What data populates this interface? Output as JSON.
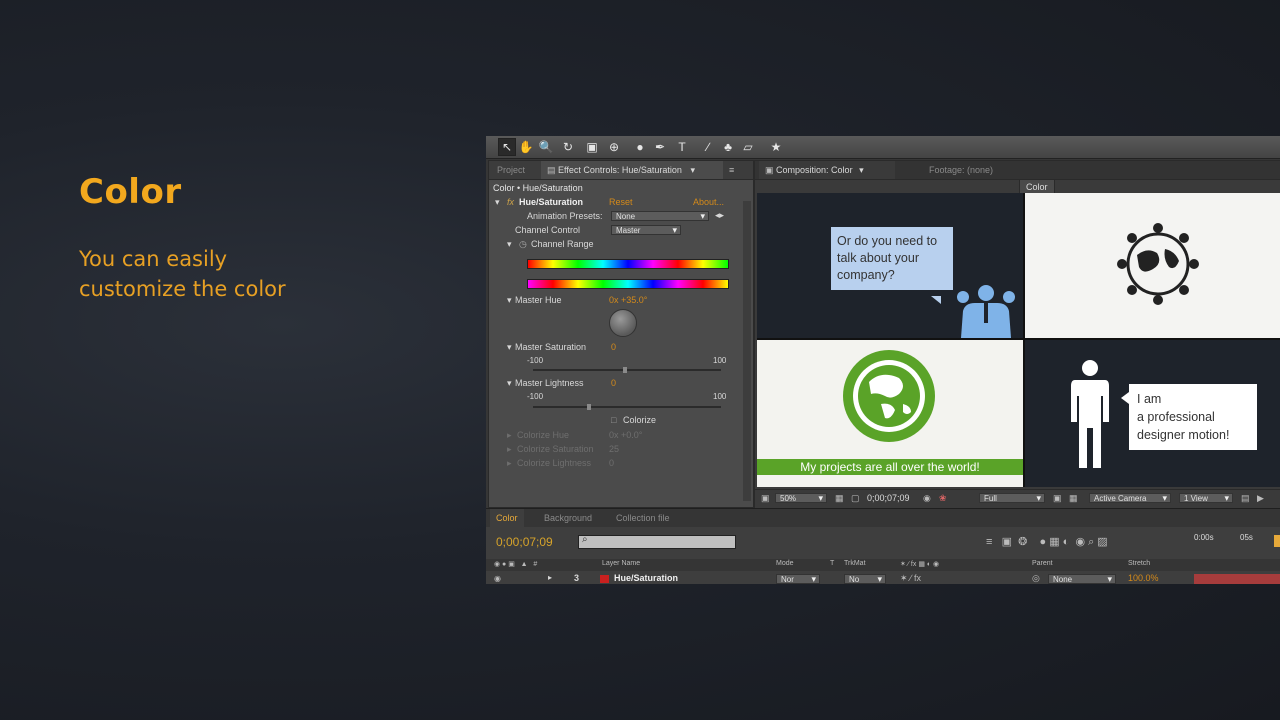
{
  "slide": {
    "heading": "Color",
    "subtext_line1": "You can easily",
    "subtext_line2": "customize the color"
  },
  "toolbar": {
    "tools": [
      "selection-tool",
      "hand-tool",
      "zoom-tool",
      "rotate-tool",
      "camera-tool",
      "pan-behind-tool",
      "shape-tool",
      "pen-tool",
      "text-tool",
      "brush-tool",
      "clone-tool",
      "eraser-tool",
      "puppet-tool"
    ]
  },
  "effect_panel": {
    "tab_project": "Project",
    "tab_effect_controls": "Effect Controls: Hue/Saturation",
    "breadcrumb": "Color • Hue/Saturation",
    "effect_name": "Hue/Saturation",
    "reset": "Reset",
    "about": "About...",
    "animation_presets_label": "Animation Presets:",
    "animation_presets_value": "None",
    "channel_control_label": "Channel Control",
    "channel_control_value": "Master",
    "channel_range_label": "Channel Range",
    "master_hue_label": "Master Hue",
    "master_hue_value": "0x +35.0°",
    "master_saturation_label": "Master Saturation",
    "master_saturation_value": "0",
    "saturation_min": "-100",
    "saturation_max": "100",
    "master_lightness_label": "Master Lightness",
    "master_lightness_value": "0",
    "lightness_min": "-100",
    "lightness_max": "100",
    "colorize_label": "Colorize",
    "colorize_hue_label": "Colorize Hue",
    "colorize_hue_value": "0x +0.0°",
    "colorize_saturation_label": "Colorize Saturation",
    "colorize_saturation_value": "25",
    "colorize_lightness_label": "Colorize Lightness",
    "colorize_lightness_value": "0"
  },
  "composition_panel": {
    "tab_composition": "Composition: Color",
    "tab_footage": "Footage: (none)",
    "comp_tab": "Color",
    "bubble_top_line1": "Or do you need to",
    "bubble_top_line2": "talk about your",
    "bubble_top_line3": "company?",
    "bubble_right_line1": "I am",
    "bubble_right_line2": "a professional",
    "bubble_right_line3": "designer motion!",
    "banner_text": "My projects are all over the world!",
    "zoom": "50%",
    "timecode": "0;00;07;09",
    "resolution": "Full",
    "camera": "Active Camera",
    "views": "1 View"
  },
  "timeline": {
    "tab_color": "Color",
    "tab_background": "Background",
    "tab_collection": "Collection file",
    "timecode": "0;00;07;09",
    "search_placeholder": "",
    "col_layer_name": "Layer Name",
    "col_mode": "Mode",
    "col_t": "T",
    "col_trkmat": "TrkMat",
    "col_parent": "Parent",
    "col_stretch": "Stretch",
    "ruler_start": "0:00s",
    "ruler_mark": "05s",
    "layer_number": "3",
    "layer_name": "Hue/Saturation",
    "layer_mode": "Nor",
    "layer_trkmat": "No",
    "layer_parent": "None",
    "layer_stretch": "100.0%"
  },
  "colors": {
    "accent_orange": "#f2a81e",
    "bubble_blue": "#b8d0ee",
    "globe_green": "#5aa328",
    "figure_blue": "#7fb3e8",
    "layer_label_red": "#c8201f"
  }
}
